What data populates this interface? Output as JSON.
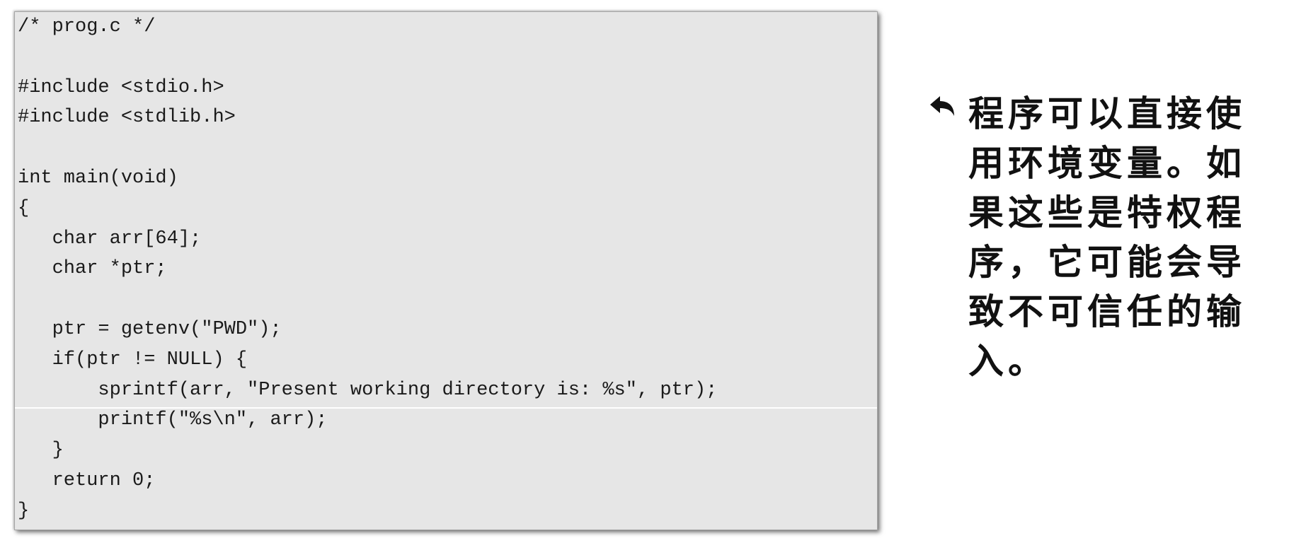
{
  "code": {
    "lines": [
      "/* prog.c */",
      "",
      "#include <stdio.h>",
      "#include <stdlib.h>",
      "",
      "int main(void)",
      "{",
      "   char arr[64];",
      "   char *ptr;",
      "",
      "   ptr = getenv(\"PWD\");",
      "   if(ptr != NULL) {",
      "       sprintf(arr, \"Present working directory is: %s\", ptr);",
      "       printf(\"%s\\n\", arr);",
      "   }",
      "   return 0;",
      "}"
    ]
  },
  "note": {
    "icon": "curved-arrow-left-icon",
    "text": "程序可以直接使用环境变量。如果这些是特权程序，它可能会导致不可信任的输入。"
  }
}
